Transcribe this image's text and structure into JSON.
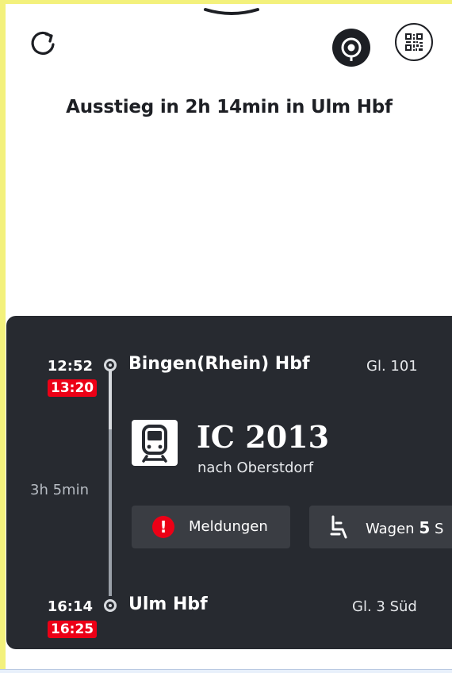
{
  "header": {
    "title": "Ausstieg in 2h 14min in Ulm Hbf"
  },
  "icons": {
    "refresh": "refresh-icon",
    "locate": "location-target-icon",
    "ticket_qr": "qr-code-icon",
    "train": "train-icon",
    "alert": "alert-icon",
    "seat": "seat-icon"
  },
  "journey": {
    "departure": {
      "planned_time": "12:52",
      "actual_time": "13:20",
      "station": "Bingen(Rhein) Hbf",
      "track": "Gl. 101"
    },
    "duration": "3h 5min",
    "train": {
      "name": "IC 2013",
      "destination": "nach Oberstdorf"
    },
    "actions": {
      "messages_label": "Meldungen",
      "wagon_label": "Wagen",
      "wagon_number": "5",
      "wagon_suffix": "S"
    },
    "arrival": {
      "planned_time": "16:14",
      "actual_time": "16:25",
      "station": "Ulm Hbf",
      "track": "Gl. 3 Süd"
    }
  },
  "colors": {
    "card_background": "#272a30",
    "delay_red": "#ec0016",
    "text_dark": "#1d1f24"
  }
}
